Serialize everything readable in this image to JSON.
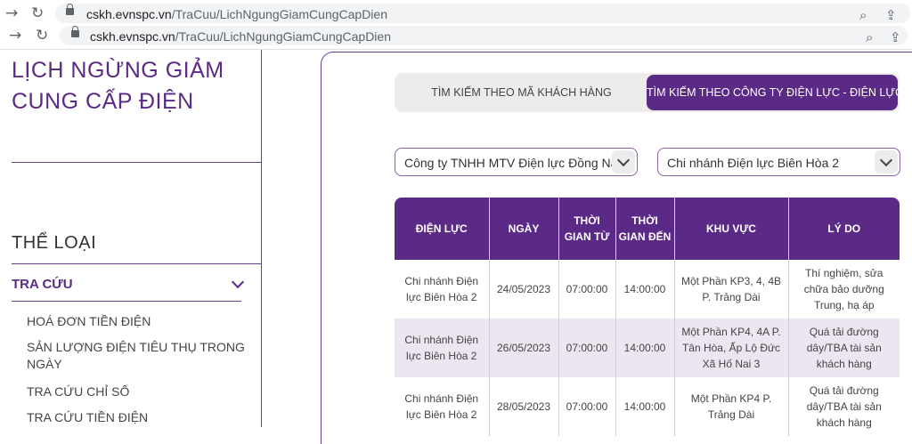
{
  "browser": {
    "url_host": "cskh.evnspc.vn",
    "url_path": "/TraCuu/LichNgungGiamCungCapDien"
  },
  "sidebar": {
    "title_line1": "LỊCH NGỪNG GIẢM",
    "title_line2": "CUNG CẤP ĐIỆN",
    "category_title": "THỂ LOẠI",
    "group_label": "TRA CỨU",
    "items": [
      "HOÁ ĐƠN TIỀN ĐIỆN",
      "SẢN LƯỢNG ĐIỆN TIÊU THỤ TRONG NGÀY",
      "TRA CỨU CHỈ SỐ",
      "TRA CỨU TIỀN ĐIỆN"
    ]
  },
  "main": {
    "tabs": [
      "TÌM KIẾM THEO MÃ KHÁCH HÀNG",
      "TÌM KIẾM THEO CÔNG TY ĐIỆN LỰC - ĐIỆN LỰC"
    ],
    "company_select": "Công ty TNHH MTV Điện lực Đồng Nai",
    "branch_select": "Chi nhánh Điện lực Biên Hòa 2",
    "table": {
      "headers": [
        "ĐIỆN LỰC",
        "NGÀY",
        "THỜI GIAN TỪ",
        "THỜI GIAN ĐẾN",
        "KHU VỰC",
        "LÝ DO"
      ],
      "rows": [
        [
          "Chi nhánh Điện lực Biên Hòa 2",
          "24/05/2023",
          "07:00:00",
          "14:00:00",
          "Một Phần KP3, 4, 4B P. Trảng Dài",
          "Thí nghiệm, sửa chữa bảo dưỡng Trung, hạ áp"
        ],
        [
          "Chi nhánh Điện lực Biên Hòa 2",
          "26/05/2023",
          "07:00:00",
          "14:00:00",
          "Một Phần KP4, 4A P. Tân Hòa, Ấp Lộ Đức Xã Hố Nai 3",
          "Quá tải đường dây/TBA tài sản khách hàng"
        ],
        [
          "Chi nhánh Điện lực Biên Hòa 2",
          "28/05/2023",
          "07:00:00",
          "14:00:00",
          "Một Phần KP4 P. Trảng Dài",
          "Quá tải đường dây/TBA tài sản khách hàng"
        ]
      ]
    }
  },
  "colors": {
    "brand_purple": "#5b2a86",
    "row_alt": "#ece6f1"
  }
}
